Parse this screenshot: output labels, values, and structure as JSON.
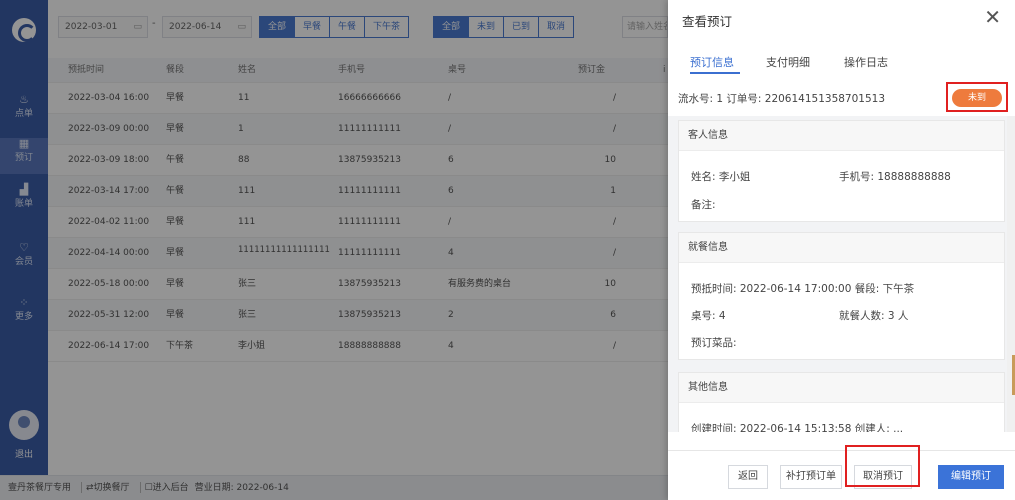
{
  "sidebar": {
    "items": [
      {
        "label": "点单",
        "icon": "dish-icon"
      },
      {
        "label": "预订",
        "icon": "calendar-icon"
      },
      {
        "label": "账单",
        "icon": "chart-icon"
      },
      {
        "label": "会员",
        "icon": "member-icon"
      },
      {
        "label": "更多",
        "icon": "grid-icon"
      }
    ],
    "logout_label": "退出"
  },
  "toolbar": {
    "start_date": "2022-03-01",
    "end_date": "2022-06-14",
    "date_sep": "-",
    "meal_filter": [
      "全部",
      "早餐",
      "午餐",
      "下午茶"
    ],
    "status_filter": [
      "全部",
      "未到",
      "已到",
      "取消"
    ],
    "search_placeholder": "请输入姓名"
  },
  "table": {
    "headers": [
      "预抵时间",
      "餐段",
      "姓名",
      "手机号",
      "桌号",
      "预订金",
      "i"
    ],
    "rows": [
      {
        "time": "2022-03-04 16:00",
        "meal": "早餐",
        "name": "11",
        "phone": "16666666666",
        "table": "/",
        "deposit": "/"
      },
      {
        "time": "2022-03-09 00:00",
        "meal": "早餐",
        "name": "1",
        "phone": "11111111111",
        "table": "/",
        "deposit": "/"
      },
      {
        "time": "2022-03-09 18:00",
        "meal": "午餐",
        "name": "88",
        "phone": "13875935213",
        "table": "6",
        "deposit": "10"
      },
      {
        "time": "2022-03-14 17:00",
        "meal": "午餐",
        "name": "111",
        "phone": "11111111111",
        "table": "6",
        "deposit": "1"
      },
      {
        "time": "2022-04-02 11:00",
        "meal": "早餐",
        "name": "111",
        "phone": "11111111111",
        "table": "/",
        "deposit": "/"
      },
      {
        "time": "2022-04-14 00:00",
        "meal": "早餐",
        "name": "11111111111111111",
        "phone": "11111111111",
        "table": "4",
        "deposit": "/"
      },
      {
        "time": "2022-05-18 00:00",
        "meal": "早餐",
        "name": "张三",
        "phone": "13875935213",
        "table": "有服务费的桌台",
        "deposit": "10"
      },
      {
        "time": "2022-05-31 12:00",
        "meal": "早餐",
        "name": "张三",
        "phone": "13875935213",
        "table": "2",
        "deposit": "6"
      },
      {
        "time": "2022-06-14 17:00",
        "meal": "下午茶",
        "name": "李小姐",
        "phone": "18888888888",
        "table": "4",
        "deposit": "/"
      }
    ]
  },
  "footer": {
    "store": "壹丹茶餐厅专用",
    "switch": "⇄切换餐厅",
    "backend": "☐进入后台",
    "biz_date": "营业日期: 2022-06-14"
  },
  "drawer": {
    "title": "查看预订",
    "tabs": [
      "预订信息",
      "支付明细",
      "操作日志"
    ],
    "order_line": "流水号: 1  订单号: 220614151358701513",
    "status": "未到",
    "guest_section": "客人信息",
    "guest_name": "姓名: 李小姐",
    "guest_phone": "手机号: 18888888888",
    "guest_note": "备注:",
    "dining_section": "就餐信息",
    "arrival": "预抵时间: 2022-06-14 17:00:00 餐段: 下午茶",
    "table_no": "桌号: 4",
    "diners": "就餐人数: 3 人",
    "dishes": "预订菜品:",
    "other_section": "其他信息",
    "other_partial": "创建时间: 2022-06-14 15:13:58 创建人: ...",
    "buttons": {
      "back": "返回",
      "reprint": "补打预订单",
      "cancel": "取消预订",
      "edit": "编辑预订"
    }
  },
  "colors": {
    "sidebar": "#3b5da8",
    "primary": "#3b73d8",
    "status_pill": "#ee7b3d",
    "highlight": "#e02020"
  }
}
